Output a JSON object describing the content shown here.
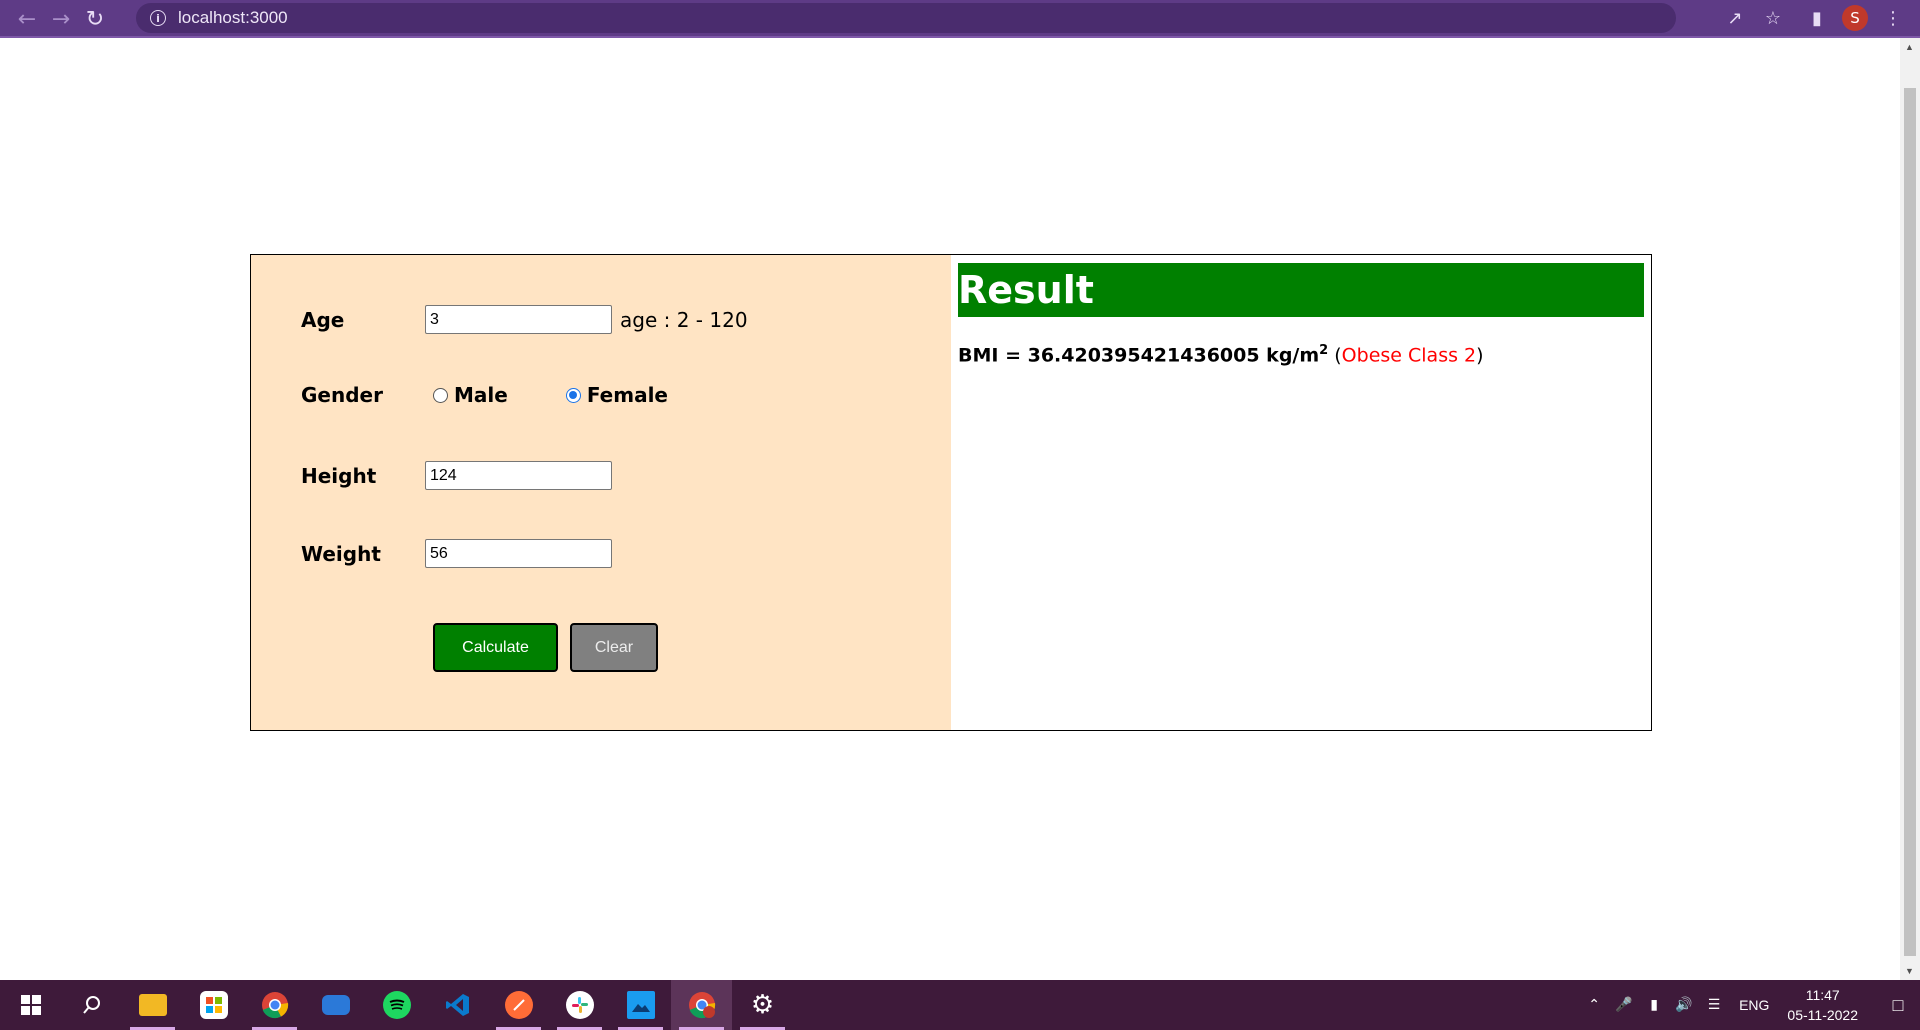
{
  "browser": {
    "url": "localhost:3000",
    "profile_initial": "S"
  },
  "form": {
    "age_label": "Age",
    "age_value": "3",
    "age_hint": "age : 2 - 120",
    "gender_label": "Gender",
    "gender_options": [
      "Male",
      "Female"
    ],
    "gender_selected": "Female",
    "height_label": "Height",
    "height_value": "124",
    "weight_label": "Weight",
    "weight_value": "56",
    "calculate_label": "Calculate",
    "clear_label": "Clear"
  },
  "result": {
    "title": "Result",
    "bmi_prefix": "BMI = 36.420395421436005 kg/m",
    "bmi_exponent": "2",
    "open_paren": " (",
    "category": "Obese Class 2",
    "close_paren": ")"
  },
  "taskbar": {
    "apps": [
      "windows-start",
      "search",
      "file-explorer",
      "microsoft-store",
      "chrome",
      "remote-desktop",
      "spotify",
      "vscode",
      "postman",
      "slack",
      "photos",
      "chrome-profile",
      "settings"
    ],
    "language": "ENG",
    "time": "11:47",
    "date": "05-11-2022"
  },
  "colors": {
    "accent_green": "#008000",
    "panel_bg": "#ffe4c4",
    "category_red": "#ff0000",
    "browser_bar": "#5e3b86",
    "taskbar": "#3e1a3a"
  }
}
